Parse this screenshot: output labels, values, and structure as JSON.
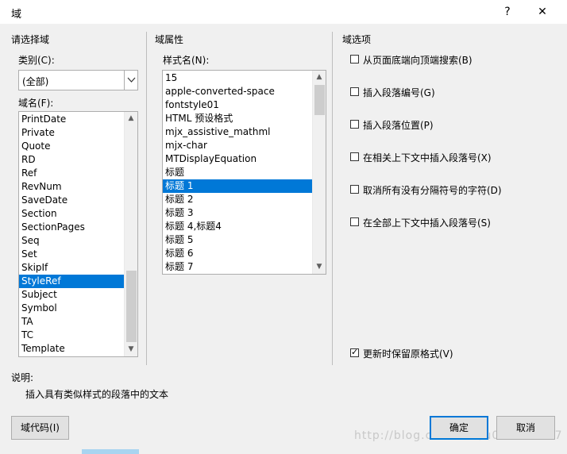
{
  "window": {
    "title": "域",
    "help_label": "?",
    "close_label": "✕"
  },
  "left": {
    "group_title": "请选择域",
    "category_label": "类别(C):",
    "category_value": "(全部)",
    "field_names_label": "域名(F):",
    "field_names": [
      "PrintDate",
      "Private",
      "Quote",
      "RD",
      "Ref",
      "RevNum",
      "SaveDate",
      "Section",
      "SectionPages",
      "Seq",
      "Set",
      "SkipIf",
      "StyleRef",
      "Subject",
      "Symbol",
      "TA",
      "TC",
      "Template"
    ],
    "selected_field": "StyleRef"
  },
  "middle": {
    "group_title": "域属性",
    "style_name_label": "样式名(N):",
    "style_names": [
      "15",
      "apple-converted-space",
      "fontstyle01",
      "HTML 预设格式",
      "mjx_assistive_mathml",
      "mjx-char",
      "MTDisplayEquation",
      "标题",
      "标题 1",
      "标题 2",
      "标题 3",
      "标题 4,标题4",
      "标题 5",
      "标题 6",
      "标题 7"
    ],
    "selected_style": "标题 1"
  },
  "right": {
    "group_title": "域选项",
    "options": [
      {
        "label": "从页面底端向顶端搜索(B)",
        "checked": false
      },
      {
        "label": "插入段落编号(G)",
        "checked": false
      },
      {
        "label": "插入段落位置(P)",
        "checked": false
      },
      {
        "label": "在相关上下文中插入段落号(X)",
        "checked": false
      },
      {
        "label": "取消所有没有分隔符号的字符(D)",
        "checked": false
      },
      {
        "label": "在全部上下文中插入段落号(S)",
        "checked": false
      }
    ],
    "preserve_format": {
      "label": "更新时保留原格式(V)",
      "checked": true
    }
  },
  "description": {
    "label": "说明:",
    "text": "插入具有类似样式的段落中的文本"
  },
  "buttons": {
    "field_codes": "域代码(I)",
    "ok": "确定",
    "cancel": "取消"
  },
  "watermark": "http://blog.csdn.net/u013928917"
}
